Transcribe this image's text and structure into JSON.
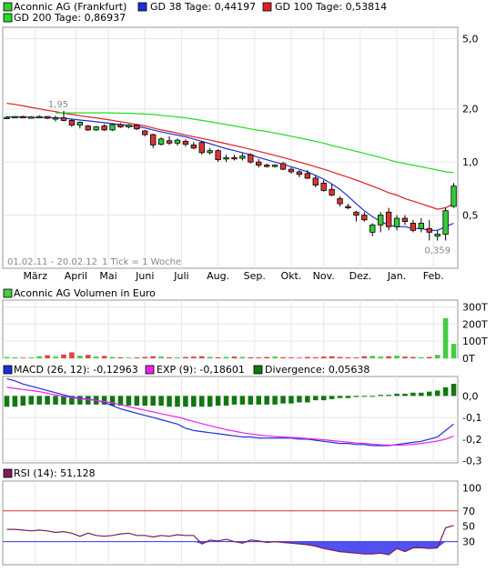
{
  "colors": {
    "gd38": "#1f2fd6",
    "gd100": "#e02020",
    "gd200": "#22dd22",
    "up": "#33cc33",
    "down": "#dd3333",
    "macd": "#1f2fd6",
    "exp": "#ee22ee",
    "divergence": "#117711",
    "rsi": "#7a1f5a",
    "rsi_fill": "#3333ee",
    "line70": "#dd3333",
    "line30": "#3333ee",
    "volume_up": "#44cc44",
    "volume_down": "#dd4444"
  },
  "legend": {
    "price": "Aconnic AG (Frankfurt)",
    "gd38": "GD 38 Tage: 0,44197",
    "gd100": "GD 100 Tage: 0,53814",
    "gd200": "GD 200 Tage: 0,86937",
    "volume": "Aconnic AG Volumen in Euro",
    "macd": "MACD (26, 12): -0,12963",
    "exp": "EXP (9): -0,18601",
    "divergence": "Divergence: 0,05638",
    "rsi": "RSI (14): 51,128"
  },
  "annotations": {
    "high": "1,95",
    "low": "0,359",
    "range": "01.02.11 - 20.02.12",
    "tick": "1 Tick = 1 Woche"
  },
  "chart_data": [
    {
      "type": "candlestick",
      "scale": "log",
      "yticks": [
        "5,0",
        "2,0",
        "1,0",
        "0,5"
      ],
      "ytick_values": [
        5.0,
        2.0,
        1.0,
        0.5
      ],
      "ylim": [
        0.25,
        5.8
      ],
      "xticks": [
        "März",
        "April",
        "Mai",
        "Juni",
        "Juli",
        "Aug.",
        "Sep.",
        "Okt.",
        "Nov.",
        "Dez.",
        "Jan.",
        "Feb."
      ],
      "xtick_weeks": [
        4,
        9,
        13,
        17.5,
        22,
        26.5,
        31,
        35.5,
        39.5,
        44,
        48.5,
        53
      ],
      "weeks": 56,
      "ohlc": [
        [
          1.78,
          1.82,
          1.76,
          1.79
        ],
        [
          1.79,
          1.82,
          1.77,
          1.81
        ],
        [
          1.81,
          1.83,
          1.77,
          1.78
        ],
        [
          1.78,
          1.82,
          1.76,
          1.8
        ],
        [
          1.8,
          1.84,
          1.78,
          1.81
        ],
        [
          1.81,
          1.82,
          1.75,
          1.77
        ],
        [
          1.76,
          1.83,
          1.7,
          1.78
        ],
        [
          1.78,
          1.95,
          1.7,
          1.72
        ],
        [
          1.72,
          1.76,
          1.58,
          1.62
        ],
        [
          1.62,
          1.7,
          1.55,
          1.68
        ],
        [
          1.6,
          1.62,
          1.5,
          1.52
        ],
        [
          1.52,
          1.6,
          1.5,
          1.58
        ],
        [
          1.6,
          1.64,
          1.5,
          1.52
        ],
        [
          1.52,
          1.65,
          1.5,
          1.63
        ],
        [
          1.63,
          1.66,
          1.56,
          1.58
        ],
        [
          1.58,
          1.64,
          1.55,
          1.62
        ],
        [
          1.62,
          1.64,
          1.52,
          1.54
        ],
        [
          1.5,
          1.52,
          1.4,
          1.43
        ],
        [
          1.43,
          1.45,
          1.2,
          1.25
        ],
        [
          1.26,
          1.38,
          1.24,
          1.35
        ],
        [
          1.32,
          1.4,
          1.25,
          1.28
        ],
        [
          1.28,
          1.36,
          1.24,
          1.33
        ],
        [
          1.31,
          1.35,
          1.22,
          1.26
        ],
        [
          1.25,
          1.3,
          1.18,
          1.2
        ],
        [
          1.29,
          1.32,
          1.1,
          1.13
        ],
        [
          1.13,
          1.2,
          1.1,
          1.16
        ],
        [
          1.16,
          1.18,
          1.0,
          1.03
        ],
        [
          1.04,
          1.1,
          1.0,
          1.06
        ],
        [
          1.06,
          1.1,
          1.02,
          1.05
        ],
        [
          1.05,
          1.12,
          1.02,
          1.08
        ],
        [
          1.1,
          1.12,
          0.98,
          1.0
        ],
        [
          1.0,
          1.04,
          0.93,
          0.96
        ],
        [
          0.96,
          0.98,
          0.93,
          0.95
        ],
        [
          0.95,
          0.97,
          0.93,
          0.96
        ],
        [
          0.98,
          1.0,
          0.9,
          0.91
        ],
        [
          0.91,
          0.93,
          0.86,
          0.88
        ],
        [
          0.88,
          0.9,
          0.82,
          0.85
        ],
        [
          0.86,
          0.9,
          0.8,
          0.81
        ],
        [
          0.81,
          0.84,
          0.72,
          0.74
        ],
        [
          0.76,
          0.79,
          0.68,
          0.69
        ],
        [
          0.7,
          0.75,
          0.64,
          0.65
        ],
        [
          0.62,
          0.64,
          0.56,
          0.58
        ],
        [
          0.56,
          0.58,
          0.54,
          0.55
        ],
        [
          0.52,
          0.53,
          0.46,
          0.5
        ],
        [
          0.5,
          0.52,
          0.46,
          0.47
        ],
        [
          0.4,
          0.45,
          0.38,
          0.44
        ],
        [
          0.44,
          0.52,
          0.4,
          0.5
        ],
        [
          0.52,
          0.55,
          0.41,
          0.43
        ],
        [
          0.43,
          0.5,
          0.41,
          0.48
        ],
        [
          0.48,
          0.5,
          0.44,
          0.46
        ],
        [
          0.45,
          0.47,
          0.4,
          0.41
        ],
        [
          0.42,
          0.48,
          0.4,
          0.45
        ],
        [
          0.42,
          0.47,
          0.36,
          0.4
        ],
        [
          0.38,
          0.41,
          0.359,
          0.39
        ],
        [
          0.39,
          0.55,
          0.359,
          0.53
        ],
        [
          0.56,
          0.76,
          0.55,
          0.73
        ]
      ],
      "series": [
        {
          "name": "GD 38 Tage",
          "values": [
            1.8,
            1.8,
            1.8,
            1.79,
            1.79,
            1.79,
            1.78,
            1.77,
            1.75,
            1.73,
            1.71,
            1.69,
            1.67,
            1.65,
            1.63,
            1.61,
            1.59,
            1.56,
            1.52,
            1.48,
            1.45,
            1.42,
            1.39,
            1.35,
            1.31,
            1.27,
            1.23,
            1.19,
            1.16,
            1.13,
            1.1,
            1.06,
            1.03,
            1.0,
            0.97,
            0.94,
            0.91,
            0.88,
            0.84,
            0.8,
            0.75,
            0.7,
            0.64,
            0.58,
            0.53,
            0.49,
            0.46,
            0.44,
            0.43,
            0.43,
            0.42,
            0.42,
            0.41,
            0.41,
            0.43,
            0.45
          ]
        },
        {
          "name": "GD 100 Tage",
          "values": [
            2.15,
            2.12,
            2.08,
            2.04,
            2.0,
            1.96,
            1.93,
            1.89,
            1.86,
            1.83,
            1.8,
            1.78,
            1.75,
            1.72,
            1.69,
            1.66,
            1.63,
            1.6,
            1.56,
            1.52,
            1.49,
            1.46,
            1.42,
            1.39,
            1.36,
            1.33,
            1.3,
            1.27,
            1.24,
            1.21,
            1.18,
            1.15,
            1.12,
            1.09,
            1.06,
            1.03,
            1.0,
            0.97,
            0.94,
            0.91,
            0.88,
            0.85,
            0.82,
            0.79,
            0.76,
            0.73,
            0.7,
            0.67,
            0.65,
            0.62,
            0.6,
            0.58,
            0.56,
            0.54,
            0.55,
            0.58
          ]
        },
        {
          "name": "GD 200 Tage",
          "values": [
            null,
            null,
            null,
            null,
            null,
            null,
            1.9,
            1.9,
            1.9,
            1.9,
            1.9,
            1.9,
            1.9,
            1.9,
            1.89,
            1.89,
            1.88,
            1.87,
            1.86,
            1.84,
            1.82,
            1.8,
            1.78,
            1.75,
            1.72,
            1.69,
            1.66,
            1.63,
            1.6,
            1.57,
            1.54,
            1.51,
            1.49,
            1.46,
            1.43,
            1.4,
            1.37,
            1.34,
            1.31,
            1.28,
            1.24,
            1.21,
            1.18,
            1.15,
            1.12,
            1.09,
            1.06,
            1.03,
            1.0,
            0.98,
            0.96,
            0.94,
            0.92,
            0.9,
            0.88,
            0.87
          ]
        }
      ]
    },
    {
      "type": "bar",
      "title": "Aconnic AG Volumen in Euro",
      "yticks": [
        "300T",
        "200T",
        "100T",
        "0T"
      ],
      "ytick_values": [
        300,
        200,
        100,
        0
      ],
      "ylim": [
        0,
        340
      ],
      "unit": "T",
      "values": [
        8,
        6,
        4,
        5,
        12,
        18,
        10,
        22,
        35,
        15,
        20,
        10,
        14,
        8,
        6,
        4,
        5,
        8,
        12,
        10,
        6,
        5,
        8,
        10,
        12,
        8,
        6,
        8,
        10,
        8,
        6,
        5,
        8,
        10,
        6,
        5,
        4,
        8,
        6,
        10,
        12,
        8,
        6,
        5,
        12,
        14,
        10,
        12,
        15,
        10,
        8,
        6,
        8,
        20,
        235,
        85
      ]
    },
    {
      "type": "line",
      "yticks": [
        "0,0",
        "-0,1",
        "-0,2",
        "-0,3"
      ],
      "ytick_values": [
        0.0,
        -0.1,
        -0.2,
        -0.3
      ],
      "ylim": [
        -0.31,
        0.09
      ],
      "series": [
        {
          "name": "MACD (26, 12)",
          "values": [
            0.08,
            0.07,
            0.055,
            0.045,
            0.035,
            0.025,
            0.015,
            0.005,
            -0.005,
            -0.01,
            -0.015,
            -0.02,
            -0.03,
            -0.045,
            -0.06,
            -0.07,
            -0.08,
            -0.09,
            -0.1,
            -0.11,
            -0.12,
            -0.13,
            -0.15,
            -0.16,
            -0.165,
            -0.17,
            -0.175,
            -0.18,
            -0.185,
            -0.19,
            -0.19,
            -0.195,
            -0.195,
            -0.195,
            -0.195,
            -0.195,
            -0.2,
            -0.2,
            -0.205,
            -0.21,
            -0.215,
            -0.22,
            -0.22,
            -0.225,
            -0.225,
            -0.23,
            -0.23,
            -0.23,
            -0.225,
            -0.22,
            -0.215,
            -0.21,
            -0.2,
            -0.19,
            -0.16,
            -0.13
          ]
        },
        {
          "name": "EXP (9)",
          "values": [
            0.04,
            0.035,
            0.03,
            0.025,
            0.02,
            0.012,
            0.005,
            -0.002,
            -0.008,
            -0.013,
            -0.017,
            -0.021,
            -0.026,
            -0.032,
            -0.04,
            -0.05,
            -0.058,
            -0.066,
            -0.074,
            -0.082,
            -0.09,
            -0.098,
            -0.108,
            -0.118,
            -0.128,
            -0.138,
            -0.147,
            -0.156,
            -0.163,
            -0.17,
            -0.176,
            -0.181,
            -0.185,
            -0.188,
            -0.19,
            -0.192,
            -0.194,
            -0.197,
            -0.2,
            -0.203,
            -0.207,
            -0.21,
            -0.214,
            -0.218,
            -0.22,
            -0.223,
            -0.226,
            -0.228,
            -0.228,
            -0.227,
            -0.224,
            -0.22,
            -0.215,
            -0.209,
            -0.2,
            -0.186
          ]
        },
        {
          "name": "Divergence",
          "values": [
            -0.05,
            -0.05,
            -0.045,
            -0.04,
            -0.04,
            -0.04,
            -0.04,
            -0.04,
            -0.04,
            -0.04,
            -0.04,
            -0.04,
            -0.04,
            -0.045,
            -0.045,
            -0.045,
            -0.045,
            -0.045,
            -0.045,
            -0.045,
            -0.05,
            -0.05,
            -0.05,
            -0.05,
            -0.05,
            -0.05,
            -0.045,
            -0.045,
            -0.04,
            -0.04,
            -0.04,
            -0.04,
            -0.04,
            -0.04,
            -0.035,
            -0.035,
            -0.03,
            -0.03,
            -0.02,
            -0.02,
            -0.015,
            -0.01,
            -0.01,
            -0.005,
            0,
            0,
            0.005,
            0.005,
            0.01,
            0.01,
            0.015,
            0.015,
            0.02,
            0.025,
            0.04,
            0.056
          ]
        }
      ]
    },
    {
      "type": "line",
      "title": "RSI (14)",
      "yticks": [
        "100",
        "70",
        "50",
        "30"
      ],
      "ytick_values": [
        100,
        70,
        50,
        30
      ],
      "ylim": [
        0,
        100
      ],
      "reference_lines": [
        70,
        30
      ],
      "series": [
        {
          "name": "RSI (14)",
          "values": [
            46,
            46,
            45,
            44,
            45,
            44,
            42,
            43,
            41,
            37,
            41,
            38,
            37,
            38,
            40,
            41,
            38,
            38,
            36,
            38,
            37,
            39,
            38,
            38,
            27,
            32,
            31,
            33,
            30,
            28,
            32,
            31,
            29,
            30,
            29,
            28,
            27,
            26,
            24,
            21,
            19,
            17,
            16,
            15,
            14,
            14,
            15,
            13,
            21,
            17,
            22,
            22,
            21,
            22,
            48,
            51
          ]
        }
      ]
    }
  ]
}
